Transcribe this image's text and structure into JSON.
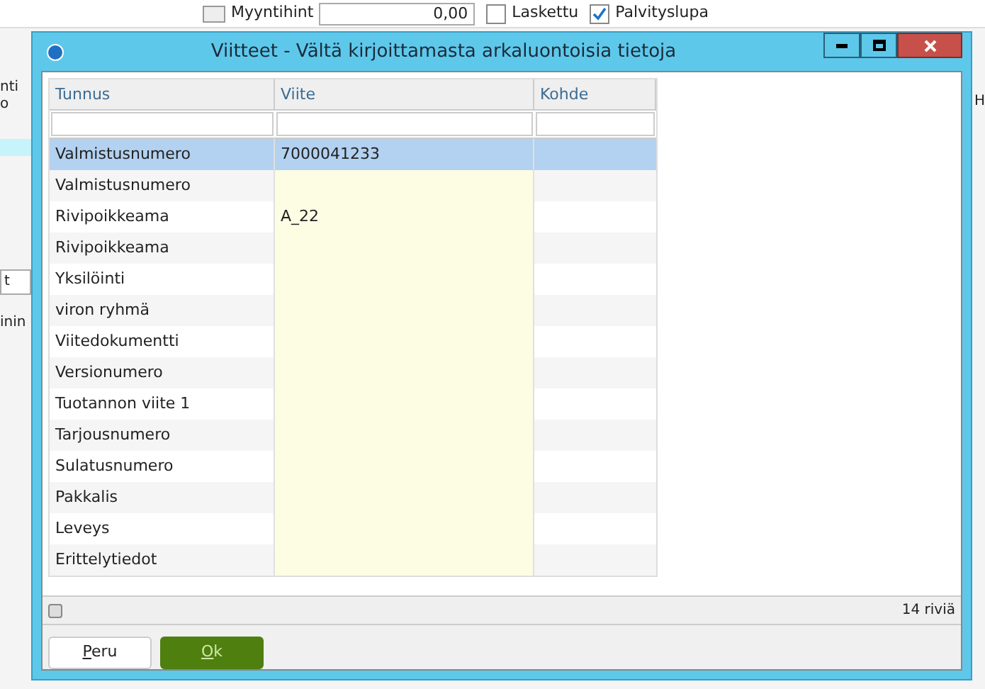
{
  "background": {
    "fields": [
      {
        "kind": "spinner",
        "label": "Myyntihint",
        "value": "0,00"
      },
      {
        "kind": "checkbox",
        "label": "Laskettu",
        "checked": false
      },
      {
        "kind": "checkbox",
        "label": "Palvityslupa",
        "checked": true
      }
    ],
    "left_fragments": [
      "nti",
      "o",
      "t",
      "inin"
    ],
    "right_fragment": "H"
  },
  "dialog": {
    "title": "Viitteet - Vältä kirjoittamasta arkaluontoisia tietoja",
    "table": {
      "columns": [
        "Tunnus",
        "Viite",
        "Kohde"
      ],
      "rows": [
        {
          "tunnus": "Valmistusnumero",
          "viite": "7000041233",
          "selected": true
        },
        {
          "tunnus": "Valmistusnumero",
          "selected": false
        },
        {
          "tunnus": "Rivipoikkeama",
          "viite": "A_22",
          "selected": false
        },
        {
          "tunnus": "Rivipoikkeama",
          "selected": false
        },
        {
          "tunnus": "Yksilöinti",
          "selected": false
        },
        {
          "tunnus": "viron ryhmä",
          "selected": false
        },
        {
          "tunnus": "Viitedokumentti",
          "selected": false
        },
        {
          "tunnus": "Versionumero",
          "selected": false
        },
        {
          "tunnus": "Tuotannon viite 1",
          "selected": false
        },
        {
          "tunnus": "Tarjousnumero",
          "selected": false
        },
        {
          "tunnus": "Sulatusnumero",
          "selected": false
        },
        {
          "tunnus": "Pakkalis",
          "selected": false
        },
        {
          "tunnus": "Leveys",
          "selected": false
        },
        {
          "tunnus": "Erittelytiedot",
          "selected": false
        }
      ]
    },
    "status": "14 riviä",
    "buttons": [
      {
        "label": "Peru",
        "kind": "secondary"
      },
      {
        "label": "Ok",
        "kind": "primary"
      }
    ]
  }
}
